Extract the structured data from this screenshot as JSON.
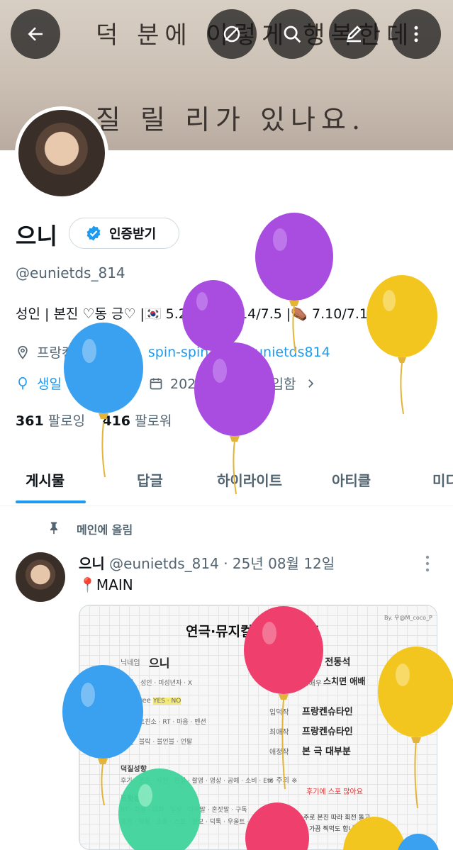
{
  "banner": {
    "line1": "덕 분에 이렇게 행복한데",
    "line2": "질 릴 리가 있나요."
  },
  "topbar": {
    "back_icon": "back-arrow-icon",
    "grok_icon": "grok-icon",
    "search_icon": "search-icon",
    "compose_icon": "compose-icon",
    "more_icon": "more-vertical-icon"
  },
  "profile": {
    "display_name": "으니",
    "verify_button_label": "인증받기",
    "handle": "@eunietds_814",
    "bio": "성인 | 본진 ♡동 긍♡ |🇰🇷 5.25/6.8/6.14/7.5 |⚰️ 7.10/7.12",
    "location": "프랑켄슈타인",
    "website": "spin-spin.com/eunietds814",
    "birthday_text": "생일 축하합니다!",
    "joined": "2024년 7월에 가입함",
    "following_count": "361",
    "following_label": "팔로잉",
    "followers_count": "416",
    "followers_label": "팔로워"
  },
  "tabs": [
    "게시물",
    "답글",
    "하이라이트",
    "아티클",
    "미디"
  ],
  "pinned": {
    "label": "메인에 올림",
    "author_name": "으니",
    "author_handle": "@eunietds_814",
    "date": "· 25년 08월 12일",
    "text": "📍MAIN"
  },
  "card": {
    "title": "연극·뮤지컬 자기소개표",
    "credit": "By. 우@M_coco_P",
    "nickname_label": "닉네임",
    "nickname": "으니",
    "bonjin_label": "본진",
    "bonjin": "박은태 전동석",
    "age_label": "나이",
    "age_items": "성인 · 미성년자 · X",
    "bujin_label": "부본진 · 애정배우",
    "bujin": "스치면 애배",
    "fub_label": "FUB free",
    "fub_items": "YES · NO",
    "ipdeok_label": "입덕작",
    "ipdeok": "프랑켄슈타인",
    "mat_label": "맞팔",
    "mat_items": "트친소 · RT · 마음 · 멘션",
    "choeae_label": "최애작",
    "choeae": "프랑켄슈타인",
    "ibyeol_label": "이별",
    "ibyeol_items": "블락 · 블언블 · 언팔",
    "aejeong_label": "애정작",
    "aejeong": "본 극 대부분",
    "deokjil_label": "덕질성향",
    "deokjil_items": "후기 · 굿즈 · 사진 · 편집 · 촬영 · 영상 · 공예 · 소비 · Etc",
    "warning_label": "※ 주의 ※",
    "warning_text": "후기에 스포 많아요",
    "tweet_label": "트윗성향",
    "tweet_items1": "RT · 마음 · 대화 · 일상 · 아무말 · 혼잣말 · 구독",
    "tweet_items2": "후기 · 덕질 · 소통 · 스포 · 정보 · 덕톡 · 우울트 · Etc",
    "etc_label": "그외 Etc",
    "etc_line1": "주로 본진 따라 회전 돌고",
    "etc_line2": "가끔 찍먹도 합니다"
  },
  "colors": {
    "accent": "#1d9bf0",
    "text": "#0f1419",
    "muted": "#536471",
    "balloon_purple": "#a94ce0",
    "balloon_yellow": "#f2c61f",
    "balloon_blue": "#3aa0f0",
    "balloon_pink": "#ef3f6d",
    "balloon_green": "#3fd39b"
  }
}
